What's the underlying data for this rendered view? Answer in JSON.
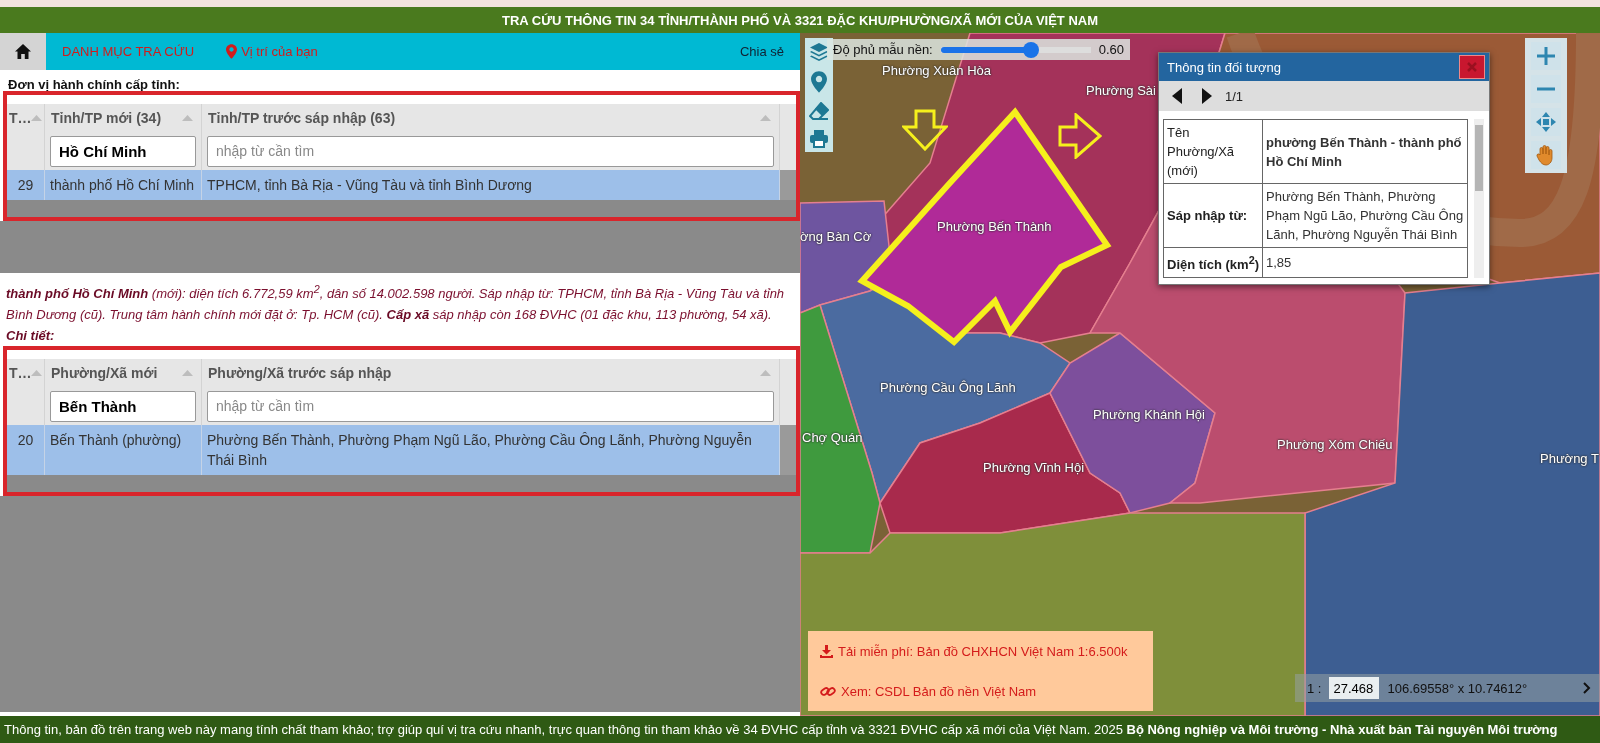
{
  "header": {
    "title": "TRA CỨU THÔNG TIN 34 TỈNH/THÀNH PHỐ VÀ 3321 ĐẶC KHU/PHƯỜNG/XÃ MỚI CỦA VIỆT NAM"
  },
  "nav": {
    "items": [
      {
        "kind": "home",
        "selected": true
      },
      {
        "kind": "menu",
        "label": "DANH MỤC TRA CỨU",
        "selected": false
      },
      {
        "kind": "location",
        "label": "Vị trí của bạn",
        "selected": false
      }
    ],
    "share": "Chia sẻ"
  },
  "province_section": {
    "title": "Đơn vị hành chính cấp tỉnh:",
    "grid": {
      "columns": [
        {
          "label": "T…"
        },
        {
          "label": "Tỉnh/TP mới (34)",
          "filter": {
            "value": "Hồ Chí Minh"
          }
        },
        {
          "label": "Tỉnh/TP trước sáp nhập (63)",
          "filter": {
            "placeholder": "nhập từ cần tìm"
          }
        }
      ],
      "rows": [
        {
          "cells": [
            "29",
            "thành phố Hồ Chí Minh",
            "TPHCM, tỉnh Bà Rịa - Vũng Tàu và tỉnh Bình Dương"
          ],
          "selected": true
        }
      ]
    }
  },
  "summary": {
    "text": "**thành phố Hồ Chí Minh** (mới): diện tích 6.772,59 km$^{2}$, dân số 14.002.598 người. Sáp nhập từ: TPHCM, tỉnh Bà Rịa - Vũng Tàu và tỉnh Bình Dương (cũ). Trung tâm hành chính mới đặt ở: Tp. HCM (cũ). **Cấp xã** sáp nhập còn 168 ĐVHC (01 đặc khu, 113 phường, 54 xã).",
    "detail_label": "Chi tiết:"
  },
  "ward_section": {
    "grid": {
      "columns": [
        {
          "label": "T…"
        },
        {
          "label": "Phường/Xã mới",
          "filter": {
            "value": "Bến Thành"
          }
        },
        {
          "label": "Phường/Xã trước sáp nhập",
          "filter": {
            "placeholder": "nhập từ cần tìm"
          }
        }
      ],
      "rows": [
        {
          "cells": [
            "20",
            "Bến Thành (phường)",
            "Phường Bến Thành, Phường Phạm Ngũ Lão, Phường Cầu Ông Lãnh, Phường Nguyễn Thái Bình"
          ],
          "selected": true
        }
      ]
    }
  },
  "map": {
    "opacity": {
      "label": "Độ phủ mẫu nền:",
      "level": 0.6,
      "reading": "0.60"
    },
    "labels": [
      "Phường Xuân Hòa",
      "Phường Sài",
      "ờng Bàn Cờ",
      "Phường Bến Thành",
      "Phường Cầu Ông Lãnh",
      "Chợ Quán",
      "Phường Khánh Hội",
      "Phường Vĩnh Hội",
      "Phường Xóm Chiếu",
      "Phường T"
    ],
    "popup": {
      "title": "Thông tin đối tượng",
      "page": "1/1",
      "rows": [
        {
          "label": "Tên Phường/Xã (mới)",
          "value": "phường Bến Thành - thành phố Hồ Chí Minh",
          "label_bold": false,
          "value_bold": true
        },
        {
          "label": "Sáp nhập từ:",
          "value": "Phường Bến Thành, Phường Phạm Ngũ Lão, Phường Cầu Ông Lãnh, Phường Nguyễn Thái Bình",
          "label_bold": true,
          "value_bold": false
        },
        {
          "label": "Diện tích (km$^{2}$)",
          "value": "1,85",
          "label_bold": true,
          "value_bold": false
        }
      ]
    },
    "links": [
      {
        "kind": "download",
        "text": "Tải miễn phí: Bản đồ CHXHCN Việt Nam 1:6.500k"
      },
      {
        "kind": "link",
        "text": "Xem: CSDL Bản đồ nền Việt Nam"
      }
    ],
    "scale": {
      "prefix": "1 :",
      "value": "27.468"
    },
    "coordinates": "106.69558° x 10.74612°"
  },
  "footer": {
    "text": "Thông tin, bản đồ trên trang web này mang tính chất tham khảo; trợ giúp quí vị tra cứu nhanh, trực quan thông tin tham khảo về 34 ĐVHC cấp tỉnh và 3321 ĐVHC cấp xã mới của Việt Nam. 2025  **Bộ Nông nghiệp và Môi trường - Nhà xuất bản Tài nguyên Môi trường**"
  }
}
